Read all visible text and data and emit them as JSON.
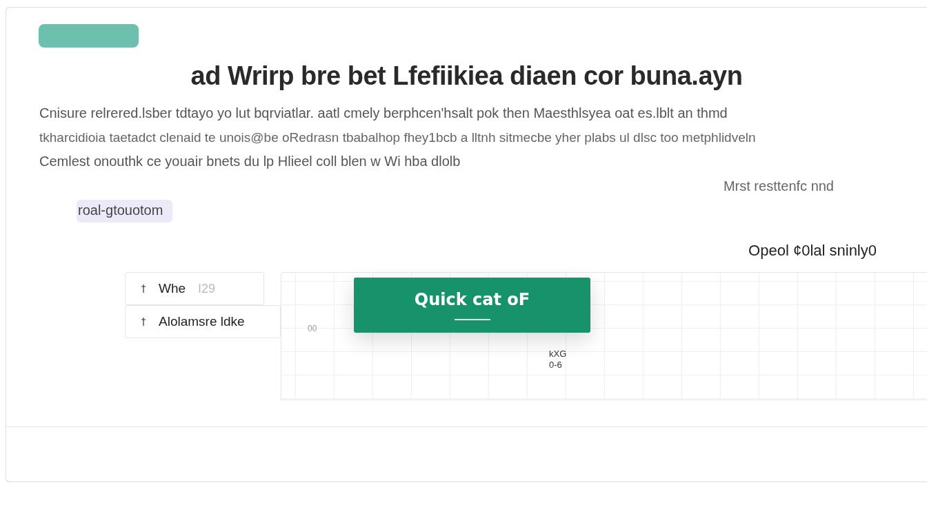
{
  "title": "ad  Wrirp bre bet Lfefiikiea diaen cor buna.ayn",
  "paragraph_lines": [
    "Cnisure relrered.lsber tdtayo yo lut bqrviatlar. aatl cmely berphcen'hsalt pok then Maesthlsyea oat es.lblt an thmd",
    "tkharcidioia taetadct clenaid te unois@be oRedrasn tbabalhop fhey1bcb a lltnh sitmecbe yher plabs ul dlsc too metphlidveln",
    "Cemlest onouthk ce youair bnets du lp Hlieel coll blen w Wi hba dlolb"
  ],
  "right_note": "Mrst resttenfc nnd",
  "tag": "roal-gtouotom",
  "right_heading": "Opeol ¢0lal sninly0",
  "list": [
    {
      "label": "Whe",
      "value": "I29"
    },
    {
      "label": "Alolamsre ldke"
    }
  ],
  "chart_panel": {
    "axis_label": "00",
    "point_label": "kXG",
    "point_sub": "0-6"
  },
  "quick_button": {
    "label": "Quick cat oF"
  }
}
